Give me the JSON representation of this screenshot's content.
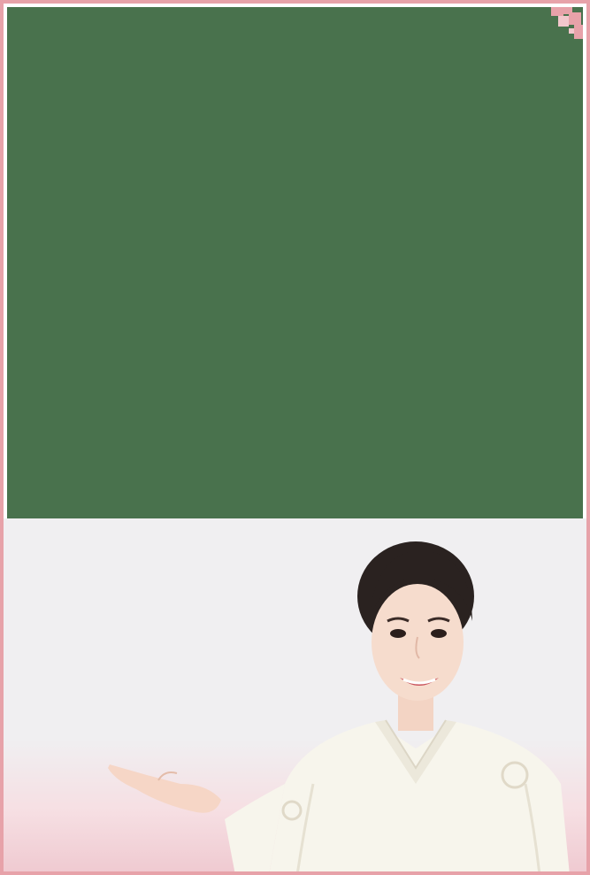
{
  "frame": {
    "border_color": "#e7a2a9",
    "panel_color": "#49724d"
  },
  "photo": {
    "subject": "woman-in-white-kimono-gesturing-left",
    "background_color": "#f0eff1",
    "accent_color": "#efc9d0"
  },
  "decorations": {
    "corner_icon": "pink-pixel-corner-icon"
  }
}
